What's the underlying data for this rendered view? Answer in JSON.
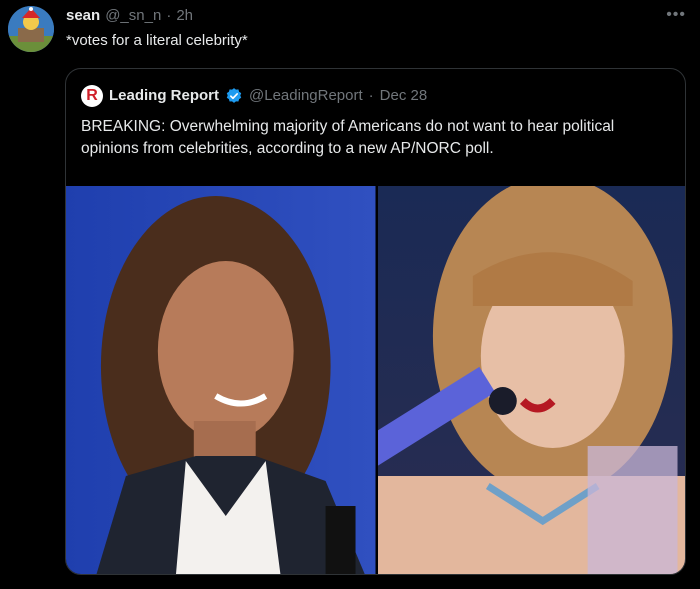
{
  "tweet": {
    "author_name": "sean",
    "author_handle": "@_sn_n",
    "separator": "·",
    "time": "2h",
    "text": "*votes for a literal celebrity*",
    "more_icon": "more-horizontal-icon"
  },
  "quote": {
    "logo_letter": "R",
    "author_name": "Leading Report",
    "verified_icon": "verified-badge-icon",
    "author_handle": "@LeadingReport",
    "separator": "·",
    "time": "Dec 28",
    "text": "BREAKING: Overwhelming majority of Americans do not want to hear political opinions from celebrities, according to a new AP/NORC poll."
  },
  "colors": {
    "background": "#000000",
    "text_primary": "#e7e9ea",
    "text_secondary": "#71767b",
    "border": "#2f3336",
    "verified_blue": "#1d9bf0"
  }
}
